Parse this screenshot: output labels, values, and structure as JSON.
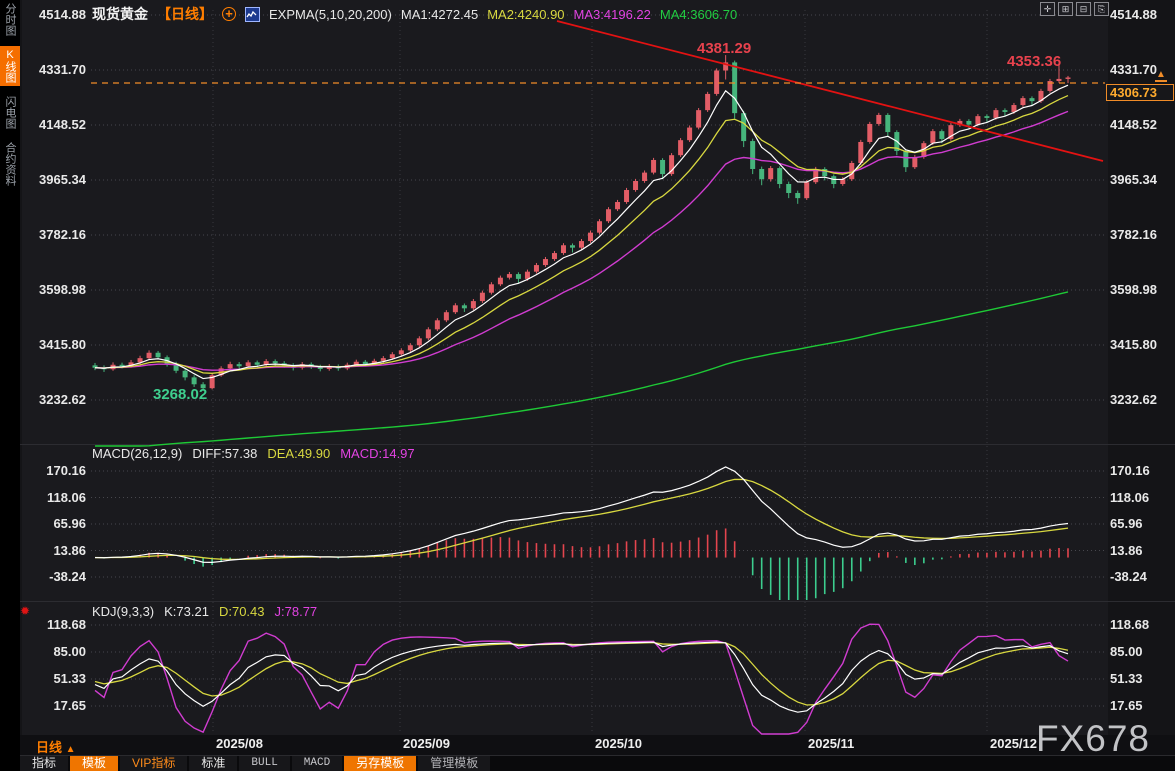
{
  "header": {
    "symbol": "现货黄金",
    "period_tag": "【日线】",
    "add_icon": "+",
    "expma_label": "EXPMA(5,10,20,200)",
    "ma1": "MA1:4272.45",
    "ma2": "MA2:4240.90",
    "ma3": "MA3:4196.22",
    "ma4": "MA4:3606.70"
  },
  "top_right_icons": [
    {
      "name": "move-icon",
      "glyph": "✛"
    },
    {
      "name": "pane-maximize-icon",
      "glyph": "⊞"
    },
    {
      "name": "pane-split-icon",
      "glyph": "⊟"
    },
    {
      "name": "pane-exit-icon",
      "glyph": "⎘"
    }
  ],
  "sidebar": {
    "items": [
      {
        "label": "分时图",
        "active": false
      },
      {
        "label": "K线图",
        "active": true
      },
      {
        "label": "闪电图",
        "active": false
      },
      {
        "label": "合约资料",
        "active": false
      }
    ]
  },
  "macd_header": {
    "title": "MACD(26,12,9)",
    "diff": "DIFF:57.38",
    "dea": "DEA:49.90",
    "macd": "MACD:14.97"
  },
  "kdj_header": {
    "title": "KDJ(9,3,3)",
    "k": "K:73.21",
    "d": "D:70.43",
    "j": "J:78.77"
  },
  "annotations": {
    "peak_high": "4381.29",
    "recent_high": "4353.36",
    "swing_low": "3268.02",
    "last_price": "4306.73"
  },
  "footer": {
    "period": "日线",
    "period_arrow": "▲",
    "tabs": [
      {
        "label": "指标",
        "style": "plain"
      },
      {
        "label": "模板",
        "style": "orange"
      },
      {
        "label": "VIP指标",
        "style": "orange-text"
      },
      {
        "label": "标准",
        "style": "plain"
      },
      {
        "label": "BULL",
        "style": "mono"
      },
      {
        "label": "MACD",
        "style": "mono"
      },
      {
        "label": "另存模板",
        "style": "orange"
      },
      {
        "label": "管理模板",
        "style": "muted"
      }
    ]
  },
  "watermark": "FX678",
  "colors": {
    "up_candle": "#e25d66",
    "down_candle": "#46b57c",
    "ma5": "#ffffff",
    "ma10": "#d8d840",
    "ma20": "#d03cd0",
    "ma200": "#1ec936",
    "trendline": "#e31212",
    "last_price_line": "#f08c28",
    "accent_orange": "#ff7e00",
    "hist_up": "#e4454e",
    "hist_down": "#3ccd8e"
  },
  "chart_data": {
    "type": "candlestick",
    "title": "现货黄金 日线 (Spot Gold daily)",
    "price_axis_labels": [
      "4514.88",
      "4331.70",
      "4148.52",
      "3965.34",
      "3782.16",
      "3598.98",
      "3415.80",
      "3232.62"
    ],
    "price_axis_values": [
      4514.88,
      4331.7,
      4148.52,
      3965.34,
      3782.16,
      3598.98,
      3415.8,
      3232.62
    ],
    "macd_axis_labels": [
      "170.16",
      "118.06",
      "65.96",
      "13.86",
      "-38.24"
    ],
    "macd_axis_values": [
      170.16,
      118.06,
      65.96,
      13.86,
      -38.24
    ],
    "kdj_axis_labels": [
      "118.68",
      "85.00",
      "51.33",
      "17.65"
    ],
    "kdj_axis_values": [
      118.68,
      85.0,
      51.33,
      17.65
    ],
    "months": [
      "2025/08",
      "2025/09",
      "2025/10",
      "2025/11",
      "2025/12"
    ],
    "indicators": {
      "expma_periods": [
        5,
        10,
        20,
        200
      ],
      "macd_params": [
        26,
        12,
        9
      ],
      "kdj_params": [
        9,
        3,
        3
      ]
    },
    "key_points": {
      "peak_high": 4381.29,
      "recent_high": 4353.36,
      "swing_low": 3268.02,
      "last": 4306.73
    },
    "ohlc": [
      [
        3348,
        3356,
        3332,
        3340
      ],
      [
        3340,
        3348,
        3326,
        3335
      ],
      [
        3335,
        3358,
        3330,
        3350
      ],
      [
        3350,
        3357,
        3338,
        3345
      ],
      [
        3345,
        3366,
        3340,
        3358
      ],
      [
        3358,
        3380,
        3352,
        3372
      ],
      [
        3372,
        3398,
        3366,
        3390
      ],
      [
        3390,
        3396,
        3368,
        3375
      ],
      [
        3375,
        3381,
        3344,
        3352
      ],
      [
        3352,
        3360,
        3322,
        3330
      ],
      [
        3330,
        3338,
        3298,
        3308
      ],
      [
        3308,
        3315,
        3276,
        3285
      ],
      [
        3285,
        3292,
        3268.02,
        3272
      ],
      [
        3272,
        3322,
        3268,
        3315
      ],
      [
        3315,
        3345,
        3310,
        3338
      ],
      [
        3338,
        3360,
        3331,
        3352
      ],
      [
        3352,
        3359,
        3337,
        3345
      ],
      [
        3345,
        3365,
        3340,
        3358
      ],
      [
        3358,
        3364,
        3342,
        3350
      ],
      [
        3350,
        3369,
        3344,
        3362
      ],
      [
        3362,
        3368,
        3347,
        3355
      ],
      [
        3355,
        3362,
        3340,
        3348
      ],
      [
        3348,
        3355,
        3331,
        3340
      ],
      [
        3340,
        3359,
        3334,
        3352
      ],
      [
        3352,
        3358,
        3336,
        3344
      ],
      [
        3344,
        3350,
        3328,
        3336
      ],
      [
        3336,
        3352,
        3330,
        3345
      ],
      [
        3345,
        3351,
        3330,
        3338
      ],
      [
        3338,
        3357,
        3332,
        3350
      ],
      [
        3350,
        3367,
        3344,
        3360
      ],
      [
        3360,
        3366,
        3344,
        3352
      ],
      [
        3352,
        3370,
        3346,
        3363
      ],
      [
        3363,
        3379,
        3357,
        3372
      ],
      [
        3372,
        3392,
        3366,
        3385
      ],
      [
        3385,
        3405,
        3379,
        3398
      ],
      [
        3398,
        3422,
        3392,
        3415
      ],
      [
        3415,
        3445,
        3409,
        3438
      ],
      [
        3438,
        3475,
        3432,
        3468
      ],
      [
        3468,
        3505,
        3462,
        3498
      ],
      [
        3498,
        3532,
        3492,
        3525
      ],
      [
        3525,
        3555,
        3519,
        3548
      ],
      [
        3548,
        3554,
        3526,
        3538
      ],
      [
        3538,
        3569,
        3532,
        3562
      ],
      [
        3562,
        3597,
        3556,
        3590
      ],
      [
        3590,
        3625,
        3584,
        3618
      ],
      [
        3618,
        3647,
        3612,
        3640
      ],
      [
        3640,
        3659,
        3634,
        3652
      ],
      [
        3652,
        3658,
        3622,
        3636
      ],
      [
        3636,
        3667,
        3630,
        3660
      ],
      [
        3660,
        3689,
        3654,
        3682
      ],
      [
        3682,
        3709,
        3676,
        3702
      ],
      [
        3702,
        3729,
        3696,
        3722
      ],
      [
        3722,
        3755,
        3716,
        3748
      ],
      [
        3748,
        3754,
        3724,
        3740
      ],
      [
        3740,
        3769,
        3734,
        3762
      ],
      [
        3762,
        3797,
        3756,
        3790
      ],
      [
        3790,
        3835,
        3784,
        3828
      ],
      [
        3828,
        3875,
        3822,
        3868
      ],
      [
        3868,
        3899,
        3862,
        3892
      ],
      [
        3892,
        3939,
        3886,
        3932
      ],
      [
        3932,
        3969,
        3926,
        3962
      ],
      [
        3962,
        3997,
        3956,
        3990
      ],
      [
        3990,
        4039,
        3984,
        4032
      ],
      [
        4032,
        4038,
        3968,
        3985
      ],
      [
        3985,
        4055,
        3979,
        4048
      ],
      [
        4048,
        4105,
        4042,
        4098
      ],
      [
        4098,
        4147,
        4092,
        4140
      ],
      [
        4140,
        4205,
        4134,
        4198
      ],
      [
        4198,
        4259,
        4192,
        4252
      ],
      [
        4252,
        4337,
        4246,
        4330
      ],
      [
        4330,
        4381.29,
        4300,
        4357
      ],
      [
        4357,
        4363,
        4170,
        4188
      ],
      [
        4188,
        4196,
        4075,
        4095
      ],
      [
        4095,
        4103,
        3985,
        4002
      ],
      [
        4002,
        4010,
        3948,
        3968
      ],
      [
        3968,
        4012,
        3960,
        4005
      ],
      [
        4005,
        4011,
        3938,
        3952
      ],
      [
        3952,
        3960,
        3905,
        3922
      ],
      [
        3922,
        3930,
        3886,
        3905
      ],
      [
        3905,
        3965,
        3899,
        3958
      ],
      [
        3958,
        4009,
        3952,
        4002
      ],
      [
        4002,
        4008,
        3964,
        3978
      ],
      [
        3978,
        3984,
        3938,
        3952
      ],
      [
        3952,
        3975,
        3946,
        3968
      ],
      [
        3968,
        4029,
        3962,
        4022
      ],
      [
        4022,
        4099,
        4016,
        4092
      ],
      [
        4092,
        4159,
        4086,
        4152
      ],
      [
        4152,
        4189,
        4146,
        4182
      ],
      [
        4182,
        4188,
        4112,
        4125
      ],
      [
        4125,
        4131,
        4048,
        4062
      ],
      [
        4062,
        4068,
        3992,
        4008
      ],
      [
        4008,
        4049,
        4002,
        4042
      ],
      [
        4042,
        4095,
        4036,
        4088
      ],
      [
        4088,
        4135,
        4082,
        4128
      ],
      [
        4128,
        4134,
        4088,
        4102
      ],
      [
        4102,
        4155,
        4096,
        4148
      ],
      [
        4148,
        4169,
        4142,
        4162
      ],
      [
        4162,
        4168,
        4136,
        4150
      ],
      [
        4150,
        4185,
        4144,
        4178
      ],
      [
        4178,
        4184,
        4158,
        4172
      ],
      [
        4172,
        4205,
        4166,
        4198
      ],
      [
        4198,
        4204,
        4178,
        4192
      ],
      [
        4192,
        4222,
        4186,
        4215
      ],
      [
        4215,
        4245,
        4209,
        4238
      ],
      [
        4238,
        4244,
        4214,
        4228
      ],
      [
        4228,
        4269,
        4222,
        4262
      ],
      [
        4262,
        4302,
        4256,
        4295
      ],
      [
        4295,
        4353.36,
        4289,
        4302
      ],
      [
        4302,
        4312,
        4288,
        4306.73
      ]
    ]
  }
}
